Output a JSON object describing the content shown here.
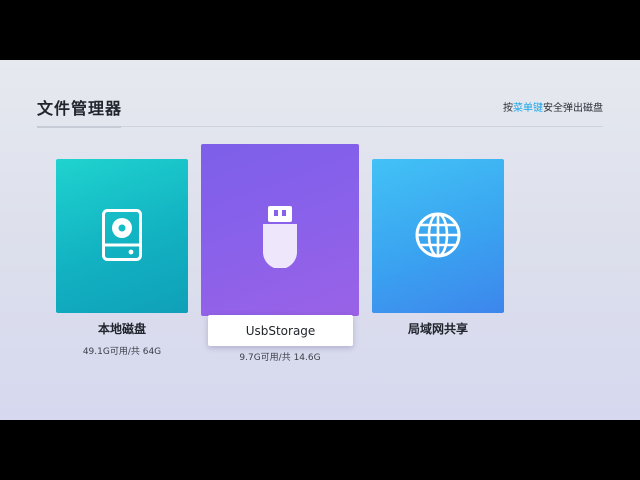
{
  "header": {
    "title": "文件管理器",
    "hint_prefix": "按",
    "hint_key": "菜单键",
    "hint_suffix": "安全弹出磁盘"
  },
  "colors": {
    "accent": "#19a6e8",
    "local_card": "#14bdc8",
    "usb_card": "#8a61ea",
    "lan_card": "#3aa3f0"
  },
  "drives": [
    {
      "name": "本地磁盘",
      "capacity": "49.1G可用/共 64G",
      "icon": "hard-disk-icon"
    },
    {
      "name": "UsbStorage",
      "capacity": "9.7G可用/共 14.6G",
      "icon": "usb-drive-icon",
      "selected": true
    },
    {
      "name": "局域网共享",
      "capacity": "",
      "icon": "globe-icon"
    }
  ]
}
